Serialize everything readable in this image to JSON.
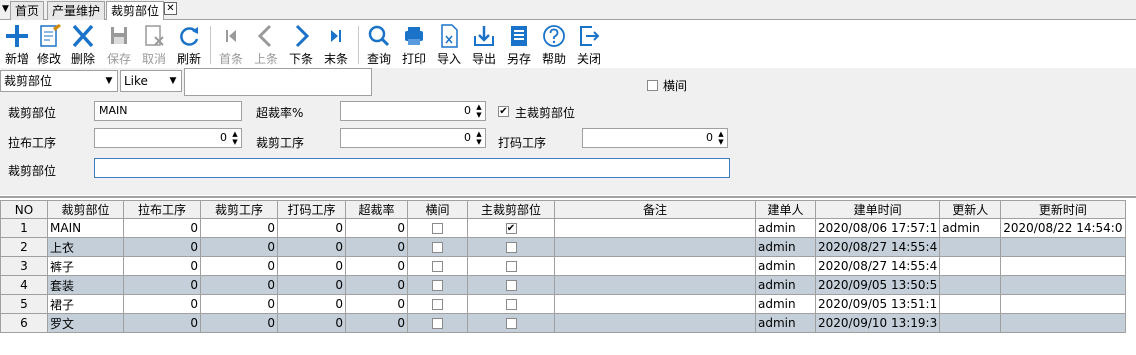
{
  "tabs": [
    {
      "label": "首页",
      "active": false
    },
    {
      "label": "产量维护",
      "active": false
    },
    {
      "label": "裁剪部位",
      "active": true
    }
  ],
  "toolbar": {
    "new": "新增",
    "edit": "修改",
    "delete": "删除",
    "save": "保存",
    "cancel": "取消",
    "refresh": "刷新",
    "first": "首条",
    "prev": "上条",
    "next": "下条",
    "last": "末条",
    "query": "查询",
    "print": "打印",
    "import": "导入",
    "export": "导出",
    "saveas": "另存",
    "help": "帮助",
    "close": "关闭"
  },
  "colors": {
    "accent": "#1a73c8",
    "alt_row": "#c4cfd9",
    "panel": "#f0f0f0"
  },
  "filter": {
    "field": "裁剪部位",
    "operator": "Like",
    "value": "",
    "hengjian_label": "横间",
    "hengjian_checked": false
  },
  "form": {
    "part_label": "裁剪部位",
    "part_value": "MAIN",
    "over_label": "超裁率%",
    "over_value": "0",
    "main_label": "主裁剪部位",
    "main_checked": true,
    "spread_label": "拉布工序",
    "spread_value": "0",
    "cut_label": "裁剪工序",
    "cut_value": "0",
    "code_label": "打码工序",
    "code_value": "0",
    "part2_label": "裁剪部位",
    "part2_value": ""
  },
  "table": {
    "columns": [
      "NO",
      "裁剪部位",
      "拉布工序",
      "裁剪工序",
      "打码工序",
      "超裁率",
      "横间",
      "主裁剪部位",
      "备注",
      "建单人",
      "建单时间",
      "更新人",
      "更新时间"
    ],
    "rows": [
      {
        "no": "1",
        "part": "MAIN",
        "spread": "0",
        "cut": "0",
        "code": "0",
        "over": "0",
        "heng": false,
        "main": true,
        "note": "",
        "creator": "admin",
        "created": "2020/08/06 17:57:1",
        "updater": "admin",
        "updated": "2020/08/22 14:54:0"
      },
      {
        "no": "2",
        "part": "上衣",
        "spread": "0",
        "cut": "0",
        "code": "0",
        "over": "0",
        "heng": false,
        "main": false,
        "note": "",
        "creator": "admin",
        "created": "2020/08/27 14:55:4",
        "updater": "",
        "updated": ""
      },
      {
        "no": "3",
        "part": "裤子",
        "spread": "0",
        "cut": "0",
        "code": "0",
        "over": "0",
        "heng": false,
        "main": false,
        "note": "",
        "creator": "admin",
        "created": "2020/08/27 14:55:4",
        "updater": "",
        "updated": ""
      },
      {
        "no": "4",
        "part": "套装",
        "spread": "0",
        "cut": "0",
        "code": "0",
        "over": "0",
        "heng": false,
        "main": false,
        "note": "",
        "creator": "admin",
        "created": "2020/09/05 13:50:5",
        "updater": "",
        "updated": ""
      },
      {
        "no": "5",
        "part": "裙子",
        "spread": "0",
        "cut": "0",
        "code": "0",
        "over": "0",
        "heng": false,
        "main": false,
        "note": "",
        "creator": "admin",
        "created": "2020/09/05 13:51:1",
        "updater": "",
        "updated": ""
      },
      {
        "no": "6",
        "part": "罗文",
        "spread": "0",
        "cut": "0",
        "code": "0",
        "over": "0",
        "heng": false,
        "main": false,
        "note": "",
        "creator": "admin",
        "created": "2020/09/10 13:19:3",
        "updater": "",
        "updated": ""
      }
    ]
  }
}
